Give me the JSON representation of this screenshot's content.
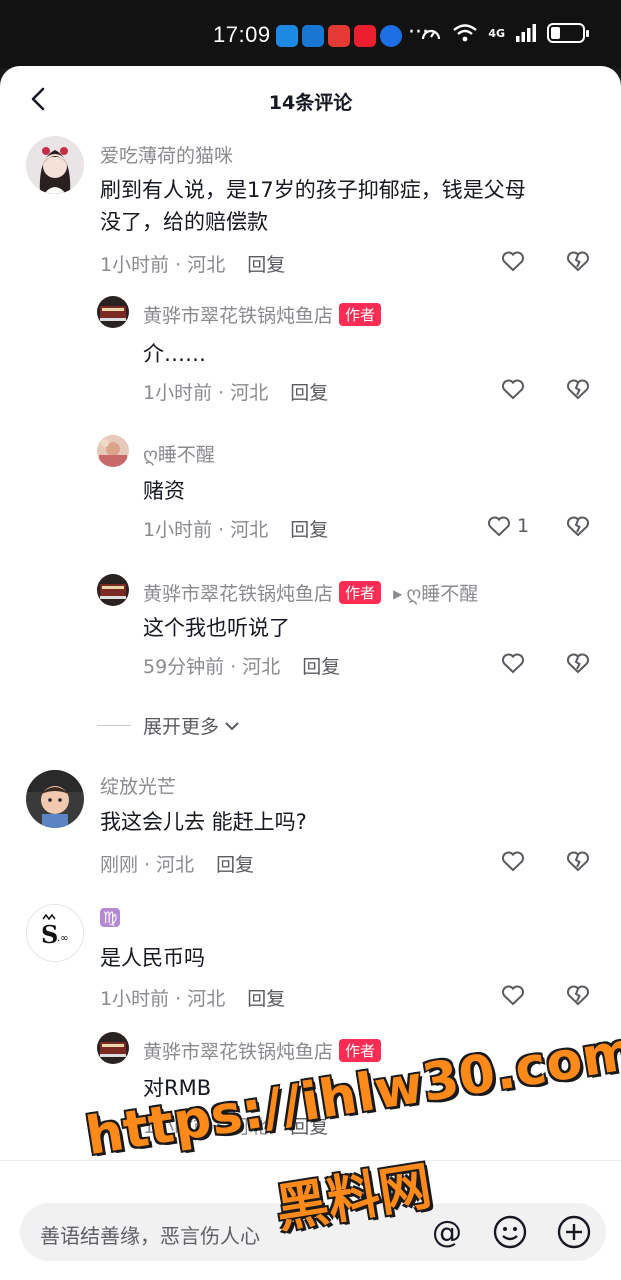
{
  "status_bar": {
    "time": "17:09",
    "dots": "···",
    "network": "4G"
  },
  "header": {
    "title": "14条评论"
  },
  "comments": [
    {
      "name": "爱吃薄荷的猫咪",
      "text_line1": "刷到有人说，是17岁的孩子抑郁症，钱是父母",
      "text_line2": "没了，给的赔偿款",
      "time": "1小时前 · 河北",
      "reply": "回复",
      "likes": ""
    },
    {
      "name": "黄骅市翠花铁锅炖鱼店",
      "author_tag": "作者",
      "text": "介……",
      "time": "1小时前 · 河北",
      "reply": "回复",
      "likes": ""
    },
    {
      "name": "ღ睡不醒",
      "text": "赌资",
      "time": "1小时前 · 河北",
      "reply": "回复",
      "likes": "1"
    },
    {
      "name": "黄骅市翠花铁锅炖鱼店",
      "author_tag": "作者",
      "reply_to": "ღ睡不醒",
      "text": "这个我也听说了",
      "time": "59分钟前 · 河北",
      "reply": "回复",
      "likes": ""
    },
    {
      "name": "绽放光芒",
      "text": "我这会儿去 能赶上吗?",
      "time": "刚刚 · 河北",
      "reply": "回复",
      "likes": ""
    },
    {
      "name": "♍",
      "text": "是人民币吗",
      "time": "1小时前 · 河北",
      "reply": "回复",
      "likes": ""
    },
    {
      "name": "黄骅市翠花铁锅炖鱼店",
      "author_tag": "作者",
      "text": "对RMB",
      "time": "1小时前 · 河北",
      "reply": "回复",
      "likes": ""
    }
  ],
  "expand": {
    "label": "展开更多"
  },
  "input": {
    "placeholder": "善语结善缘，恶言伤人心"
  },
  "watermark": {
    "line1": "https://ihlw30.com",
    "line2": "黑料网"
  },
  "colors": {
    "accent": "#fe2c55",
    "watermark": "#ff8a1a"
  }
}
